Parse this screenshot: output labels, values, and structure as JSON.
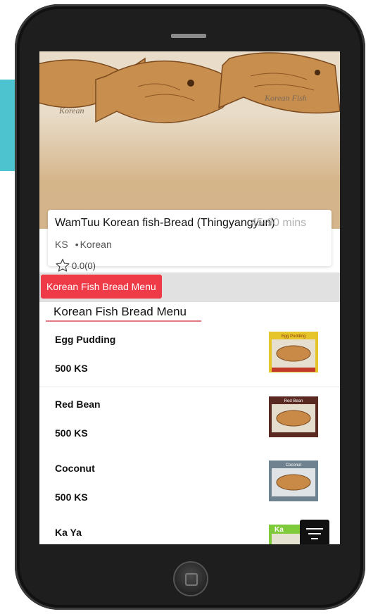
{
  "restaurant": {
    "name": "WamTuu Korean fish-Bread (Thingyangyun)",
    "delivery_time": "45-90 mins",
    "currency": "KS",
    "cuisine": "Korean",
    "rating": "0.0(0)"
  },
  "hero": {
    "label_left": "Korean",
    "label_right": "Korean Fish"
  },
  "category_tab": "Korean Fish Bread Menu",
  "section_title": "Korean Fish Bread Menu",
  "menu_items": [
    {
      "name": "Egg Pudding",
      "price": "500 KS",
      "thumb_caption": "Egg Pudding",
      "thumb_bg": "#e6c52a"
    },
    {
      "name": "Red Bean",
      "price": "500 KS",
      "thumb_caption": "Red Bean",
      "thumb_bg": "#5a2a22"
    },
    {
      "name": "Coconut",
      "price": "500 KS",
      "thumb_caption": "Coconut",
      "thumb_bg": "#6e8290"
    },
    {
      "name": "Ka Ya",
      "price": "",
      "thumb_caption": "Ka",
      "thumb_bg": "#7fca3a"
    }
  ],
  "colors": {
    "accent_red": "#ee3b47",
    "side_accent": "#4dc3cf"
  },
  "icons": [
    "star-outline-icon",
    "filter-icon",
    "home-button-icon"
  ]
}
